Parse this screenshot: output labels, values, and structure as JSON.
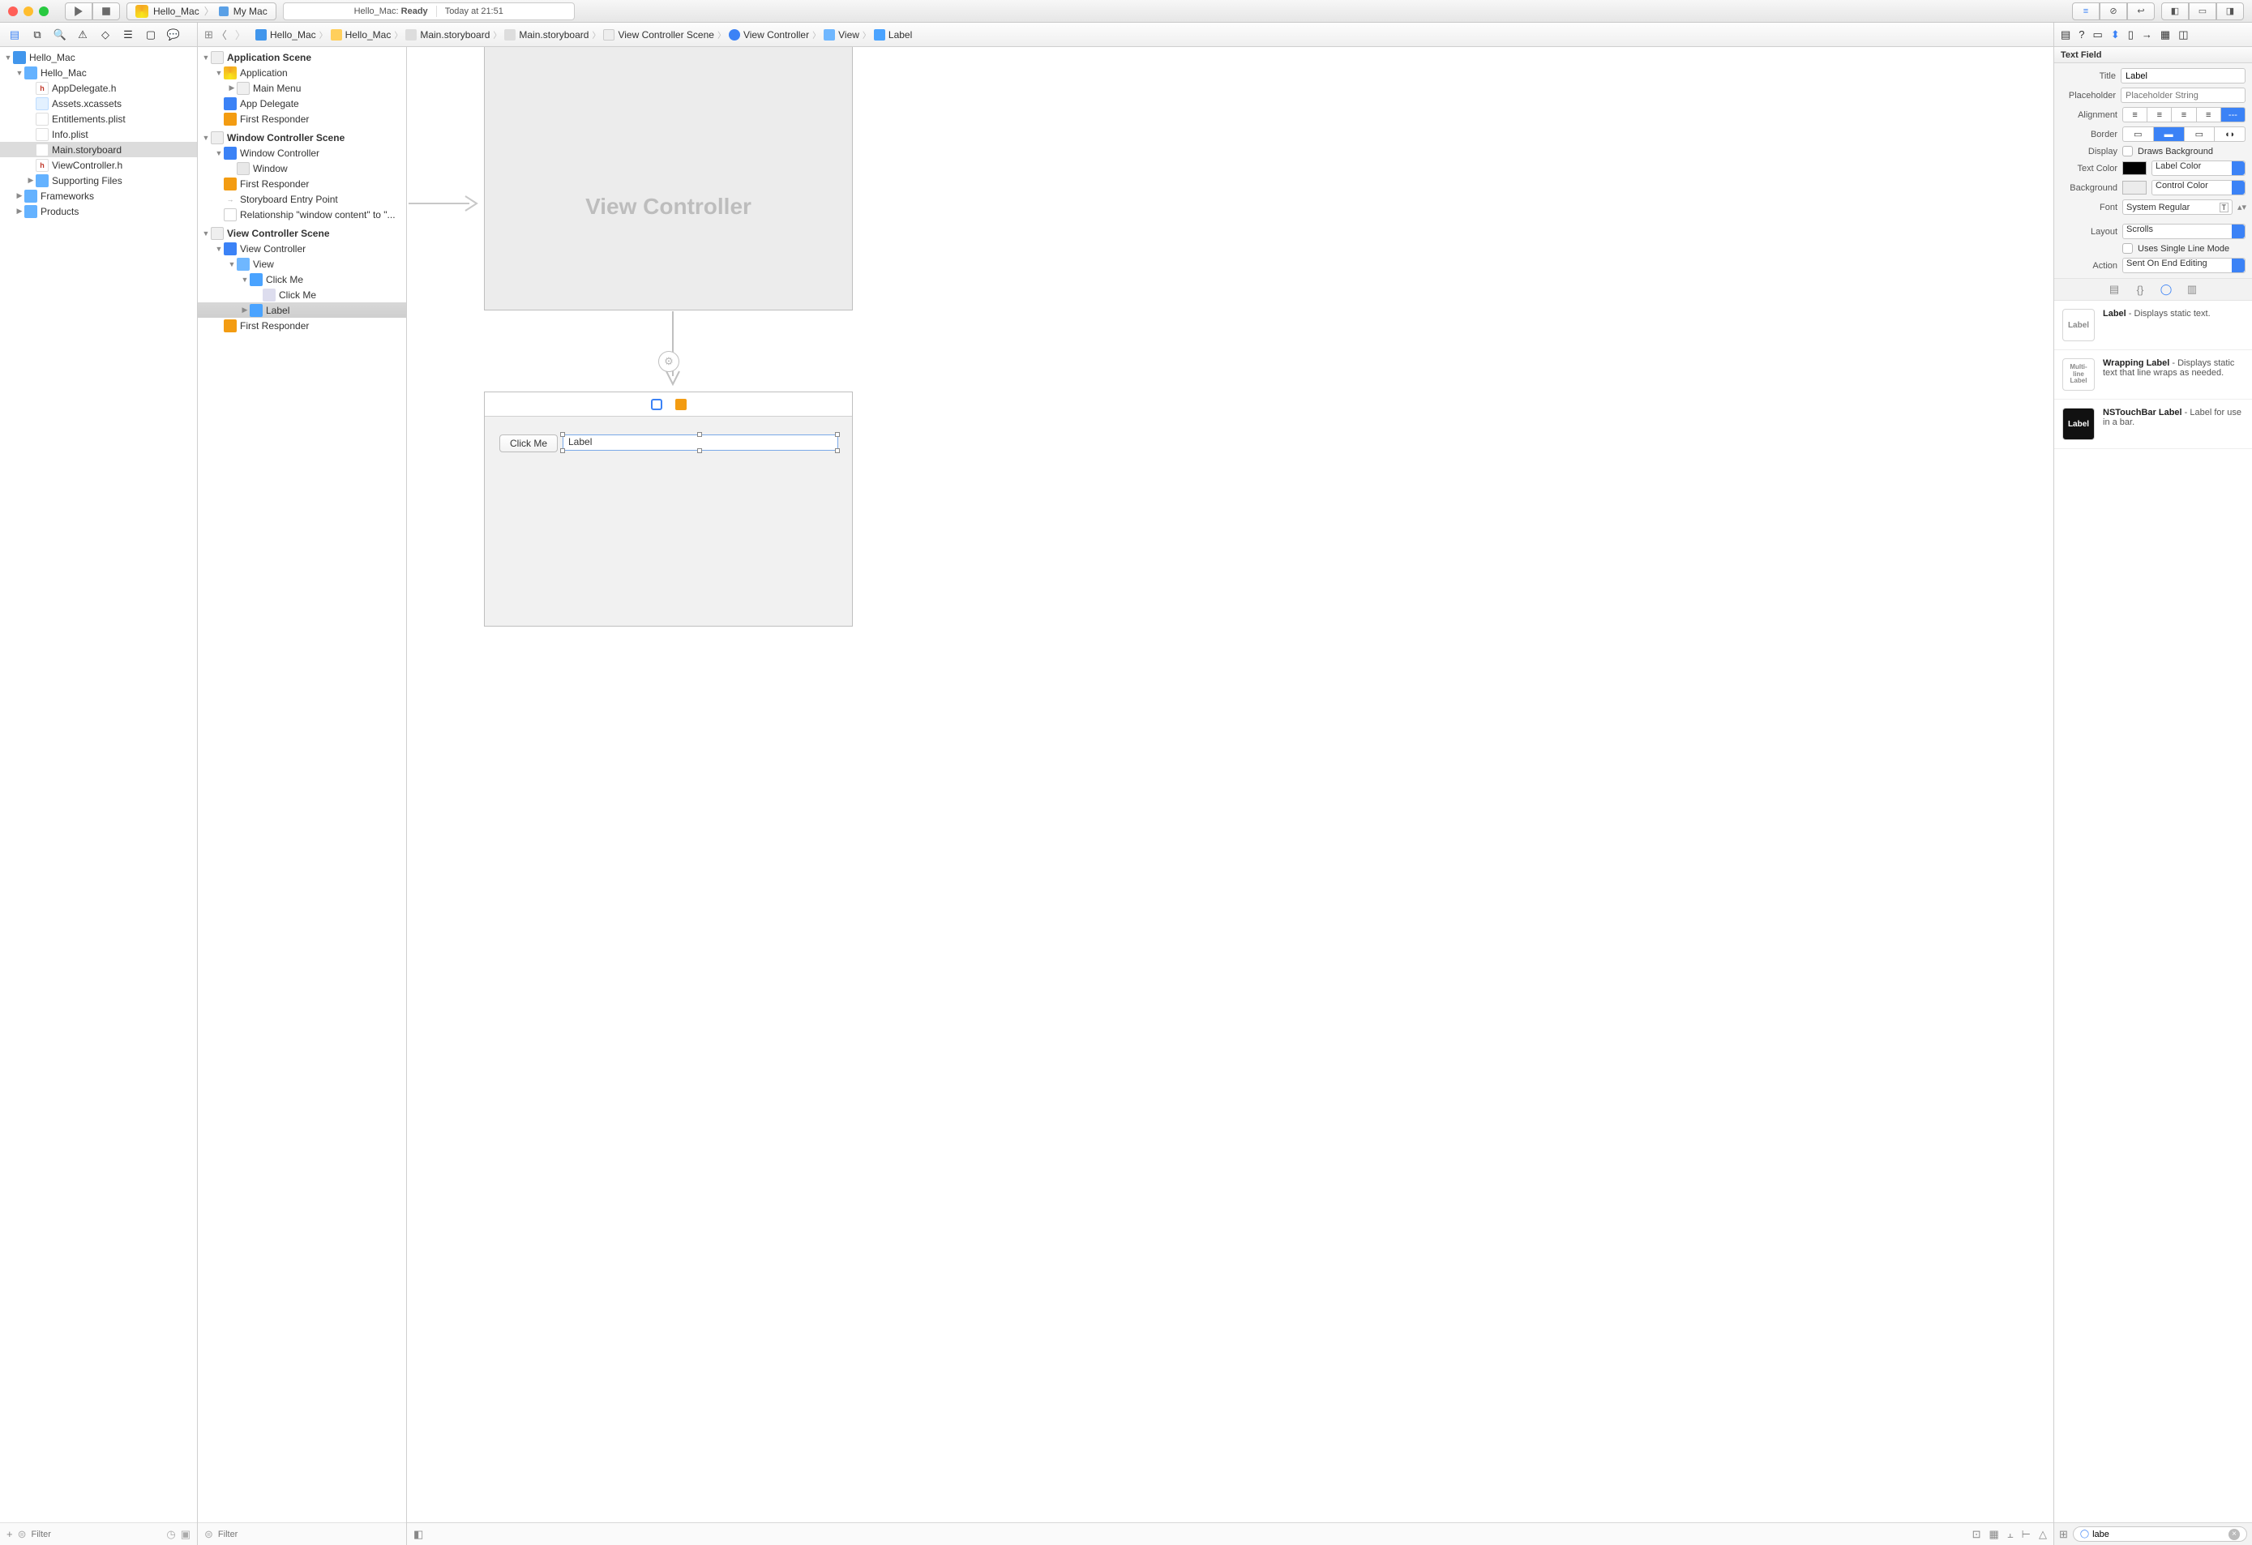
{
  "toolbar": {
    "scheme_target": "Hello_Mac",
    "scheme_device": "My Mac",
    "status_project": "Hello_Mac:",
    "status_state": "Ready",
    "status_time": "Today at 21:51"
  },
  "breadcrumbs": [
    "Hello_Mac",
    "Hello_Mac",
    "Main.storyboard",
    "Main.storyboard",
    "View Controller Scene",
    "View Controller",
    "View",
    "Label"
  ],
  "navigator": {
    "root": "Hello_Mac",
    "group": "Hello_Mac",
    "files": {
      "appdelegate": "AppDelegate.h",
      "assets": "Assets.xcassets",
      "entitlements": "Entitlements.plist",
      "info": "Info.plist",
      "storyboard": "Main.storyboard",
      "viewcontroller": "ViewController.h",
      "supporting": "Supporting Files",
      "frameworks": "Frameworks",
      "products": "Products"
    },
    "filter_placeholder": "Filter"
  },
  "outline": {
    "scenes": {
      "app": "Application Scene",
      "app_items": {
        "application": "Application",
        "mainmenu": "Main Menu",
        "appdelegate": "App Delegate",
        "firstresp": "First Responder"
      },
      "win": "Window Controller Scene",
      "win_items": {
        "wc": "Window Controller",
        "window": "Window",
        "firstresp": "First Responder",
        "entry": "Storyboard Entry Point",
        "rel": "Relationship \"window content\" to \"..."
      },
      "vc": "View Controller Scene",
      "vc_items": {
        "vc": "View Controller",
        "view": "View",
        "clickme": "Click Me",
        "clickme_cell": "Click Me",
        "label": "Label",
        "firstresp": "First Responder"
      }
    },
    "filter_placeholder": "Filter"
  },
  "canvas": {
    "vc_title": "View Controller",
    "button_label": "Click Me",
    "label_text": "Label"
  },
  "inspector": {
    "section": "Text Field",
    "title_label": "Title",
    "title_value": "Label",
    "placeholder_label": "Placeholder",
    "placeholder_placeholder": "Placeholder String",
    "alignment_label": "Alignment",
    "border_label": "Border",
    "display_label": "Display",
    "display_value": "Draws Background",
    "textcolor_label": "Text Color",
    "textcolor_value": "Label Color",
    "background_label": "Background",
    "background_value": "Control Color",
    "font_label": "Font",
    "font_value": "System Regular",
    "layout_label": "Layout",
    "layout_value": "Scrolls",
    "singleline_label": "Uses Single Line Mode",
    "action_label": "Action",
    "action_value": "Sent On End Editing"
  },
  "library": {
    "items": [
      {
        "icon": "Label",
        "title": "Label",
        "bold": "Label",
        "rest": " - Displays static text."
      },
      {
        "icon": "Multi-\nline\nLabel",
        "title": "Wrapping Label",
        "bold": "Wrapping Label",
        "rest": " - Displays static text that line wraps as needed."
      },
      {
        "icon": "Label",
        "title": "NSTouchBar Label",
        "bold": "NSTouchBar Label",
        "rest": " - Label for use in a bar.",
        "dark": true
      }
    ],
    "search_value": "labe"
  }
}
